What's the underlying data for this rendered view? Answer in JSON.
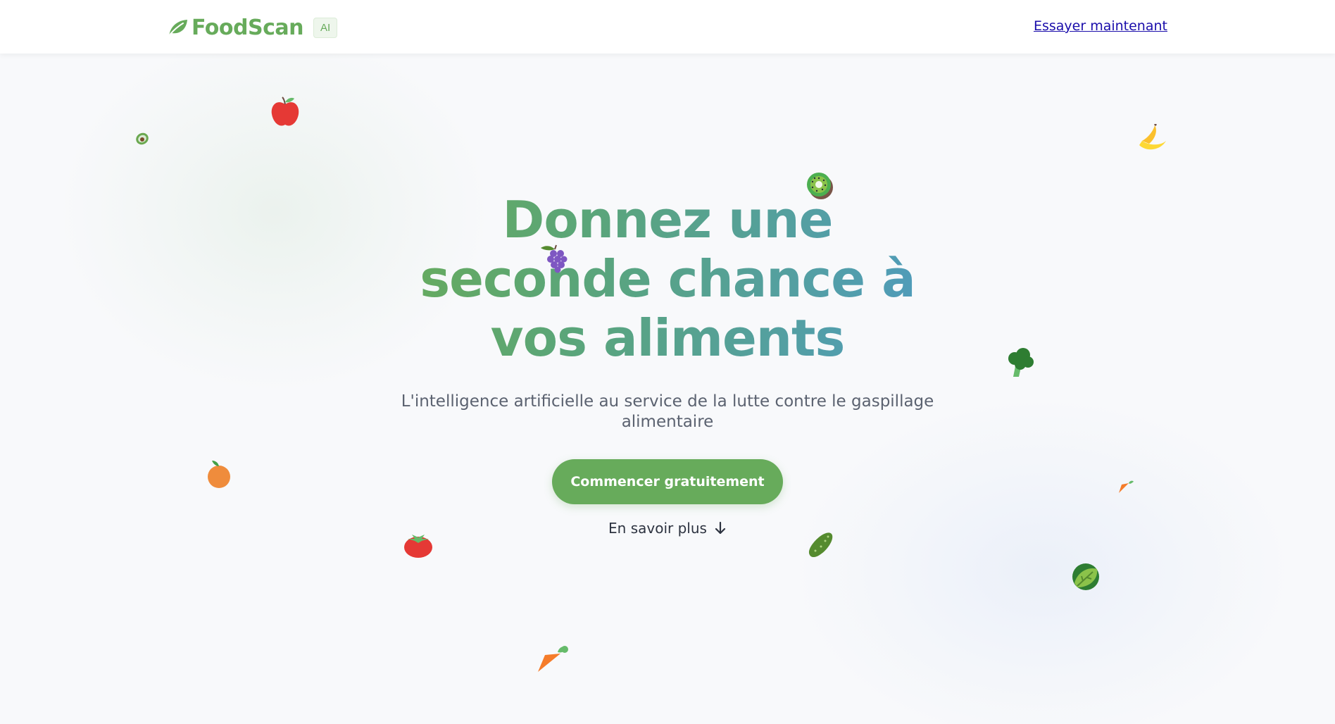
{
  "header": {
    "logo_text": "FoodScan",
    "badge": "AI",
    "nav_link": "Essayer maintenant"
  },
  "hero": {
    "title": "Donnez une seconde chance à vos aliments",
    "subtitle": "L'intelligence artificielle au service de la lutte contre le gaspillage alimentaire",
    "cta_label": "Commencer gratuitement",
    "learn_more_label": "En savoir plus"
  },
  "icons": {
    "logo": "leaf-icon",
    "learn_more": "arrow-down-icon",
    "decorations": [
      "avocado-icon",
      "apple-icon",
      "kiwi-icon",
      "banana-icon",
      "grapes-icon",
      "broccoli-icon",
      "orange-icon",
      "carrot-icon",
      "tomato-icon",
      "cucumber-icon",
      "lettuce-icon"
    ]
  },
  "colors": {
    "brand_green": "#67ab5b",
    "gradient_end": "#4f9bbf",
    "link_blue": "#1a0dab",
    "text_gray": "#5b6270"
  }
}
